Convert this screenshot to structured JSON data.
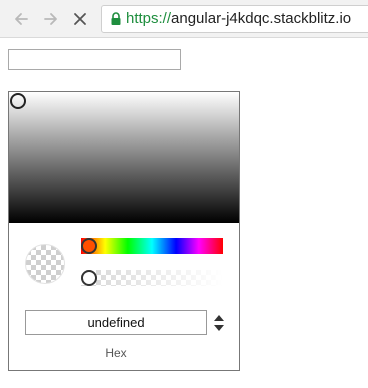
{
  "browser": {
    "url_protocol": "https://",
    "url_host": "angular-j4kdqc.stackblitz.io",
    "back_icon": "arrow-left-icon",
    "forward_icon": "arrow-right-icon",
    "stop_icon": "close-icon",
    "secure_icon": "lock-icon",
    "secure_color": "#1e8e3e"
  },
  "page": {
    "input_value": ""
  },
  "color_picker": {
    "hue_color": "#ff0000",
    "hex_value": "undefined",
    "format_label": "Hex",
    "toggle_icon": "up-down-arrows-icon"
  }
}
